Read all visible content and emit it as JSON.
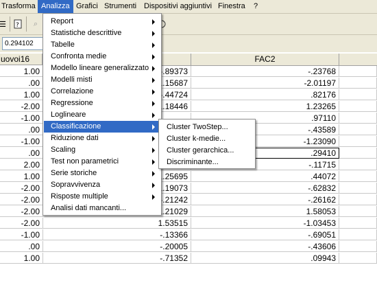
{
  "menubar": {
    "items": [
      "Trasforma",
      "Analizza",
      "Grafici",
      "Strumenti",
      "Dispositivi aggiuntivi",
      "Finestra",
      "?"
    ],
    "active": "Analizza"
  },
  "cell_editor": {
    "value": "0.294102"
  },
  "grid": {
    "columns": [
      "uovoi16",
      "",
      "FAC2"
    ],
    "rows": [
      [
        "1.00",
        "-.89373",
        "-.23768"
      ],
      [
        ".00",
        "1.15687",
        "-2.01197"
      ],
      [
        "1.00",
        "-.44724",
        ".82176"
      ],
      [
        "-2.00",
        "1.18446",
        "1.23265"
      ],
      [
        "-1.00",
        "",
        ".97110"
      ],
      [
        ".00",
        "",
        "-.43589"
      ],
      [
        "-1.00",
        "",
        "-1.23090"
      ],
      [
        ".00",
        "",
        ".29410"
      ],
      [
        "2.00",
        "1.27036",
        "-.11715"
      ],
      [
        "1.00",
        "1.25695",
        ".44072"
      ],
      [
        "-2.00",
        "1.19073",
        "-.62832"
      ],
      [
        "-2.00",
        "-.21242",
        "-.26162"
      ],
      [
        "-2.00",
        "1.21029",
        "1.58053"
      ],
      [
        "-2.00",
        "1.53515",
        "-1.03453"
      ],
      [
        "-1.00",
        "-.13366",
        "-.69051"
      ],
      [
        ".00",
        "-.20005",
        "-.43606"
      ],
      [
        "1.00",
        "-.71352",
        ".09943"
      ]
    ]
  },
  "analizza_menu": {
    "items": [
      {
        "label": "Report",
        "submenu": true
      },
      {
        "label": "Statistiche descrittive",
        "submenu": true
      },
      {
        "label": "Tabelle",
        "submenu": true
      },
      {
        "label": "Confronta medie",
        "submenu": true
      },
      {
        "label": "Modello lineare generalizzato",
        "submenu": true
      },
      {
        "label": "Modelli misti",
        "submenu": true
      },
      {
        "label": "Correlazione",
        "submenu": true
      },
      {
        "label": "Regressione",
        "submenu": true
      },
      {
        "label": "Loglineare",
        "submenu": true
      },
      {
        "label": "Classificazione",
        "submenu": true,
        "highlighted": true
      },
      {
        "label": "Riduzione dati",
        "submenu": true
      },
      {
        "label": "Scaling",
        "submenu": true
      },
      {
        "label": "Test non parametrici",
        "submenu": true
      },
      {
        "label": "Serie storiche",
        "submenu": true
      },
      {
        "label": "Sopravvivenza",
        "submenu": true
      },
      {
        "label": "Risposte multiple",
        "submenu": true
      },
      {
        "label": "Analisi dati mancanti...",
        "submenu": false
      }
    ]
  },
  "classificazione_submenu": {
    "items": [
      "Cluster TwoStep...",
      "Cluster k-medie...",
      "Cluster gerarchica...",
      "Discriminante..."
    ]
  },
  "colors": {
    "highlight": "#316ac5",
    "chrome": "#ece9d8"
  }
}
